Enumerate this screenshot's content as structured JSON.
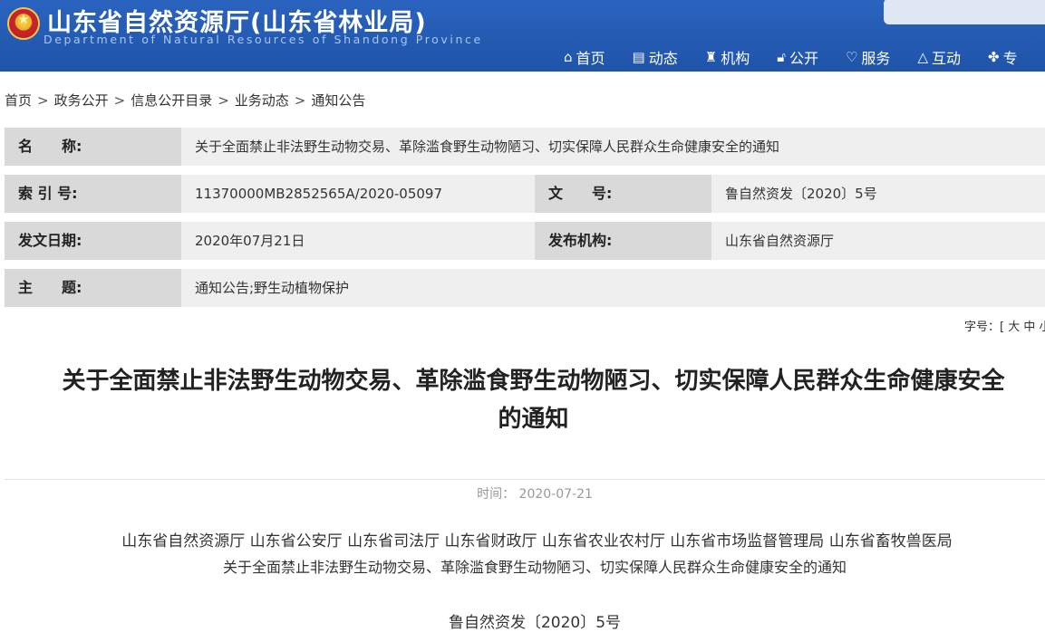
{
  "header": {
    "title": "山东省自然资源厅(山东省林业局)",
    "subtitle": "Department of Natural Resources of Shandong Province",
    "nav": [
      {
        "icon": "home-icon",
        "glyph": "⌂",
        "label": "首页"
      },
      {
        "icon": "news-icon",
        "glyph": "▤",
        "label": "动态"
      },
      {
        "icon": "org-icon",
        "glyph": "♜",
        "label": "机构"
      },
      {
        "icon": "lock-icon",
        "glyph": "🔓︎",
        "label": "公开"
      },
      {
        "icon": "heart-icon",
        "glyph": "♡",
        "label": "服务"
      },
      {
        "icon": "interact-icon",
        "glyph": "△",
        "label": "互动"
      },
      {
        "icon": "topic-icon",
        "glyph": "✤",
        "label": "专"
      }
    ]
  },
  "breadcrumb": [
    "首页",
    "政务公开",
    "信息公开目录",
    "业务动态",
    "通知公告"
  ],
  "info": {
    "name_label": "名　　称:",
    "name_value": "关于全面禁止非法野生动物交易、革除滥食野生动物陋习、切实保障人民群众生命健康安全的通知",
    "index_label": "索 引 号:",
    "index_value": "11370000MB2852565A/2020-05097",
    "docno_label": "文　　号:",
    "docno_value": "鲁自然资发〔2020〕5号",
    "date_label": "发文日期:",
    "date_value": "2020年07月21日",
    "org_label": "发布机构:",
    "org_value": "山东省自然资源厅",
    "topic_label": "主　　题:",
    "topic_value": "通知公告;野生动植物保护"
  },
  "fontsize": "字号：[ 大 中 小 ]",
  "article": {
    "title_line1": "关于全面禁止非法野生动物交易、革除滥食野生动物陋习、切实保障人民群众生命健康安全",
    "title_line2": "的通知",
    "time": "时间：  2020-07-21",
    "issuers": "山东省自然资源厅   山东省公安厅   山东省司法厅   山东省财政厅   山东省农业农村厅   山东省市场监督管理局   山东省畜牧兽医局",
    "subject": "关于全面禁止非法野生动物交易、革除滥食野生动物陋习、切实保障人民群众生命健康安全的通知",
    "doc_number": "鲁自然资发〔2020〕5号"
  }
}
